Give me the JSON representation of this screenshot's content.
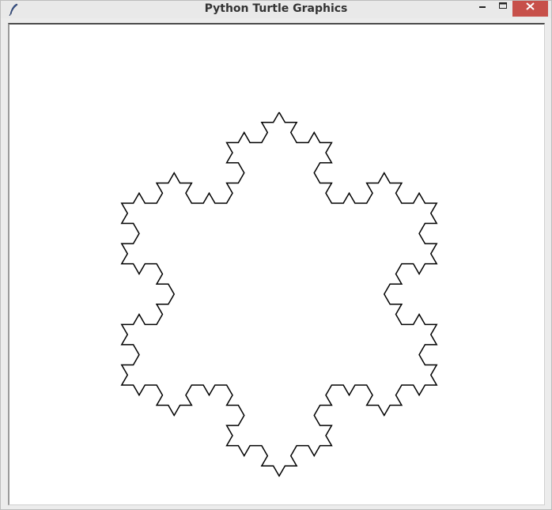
{
  "window": {
    "title": "Python Turtle Graphics",
    "buttons": {
      "minimize": "minimize",
      "maximize": "maximize",
      "close": "close"
    },
    "colors": {
      "titlebar": "#e9e9e9",
      "close_button": "#c7504a",
      "canvas_background": "#ffffff",
      "pen": "#000000"
    }
  },
  "canvas": {
    "drawing": "koch-snowflake",
    "recursion_depth": 3,
    "pen_color": "#000000"
  }
}
